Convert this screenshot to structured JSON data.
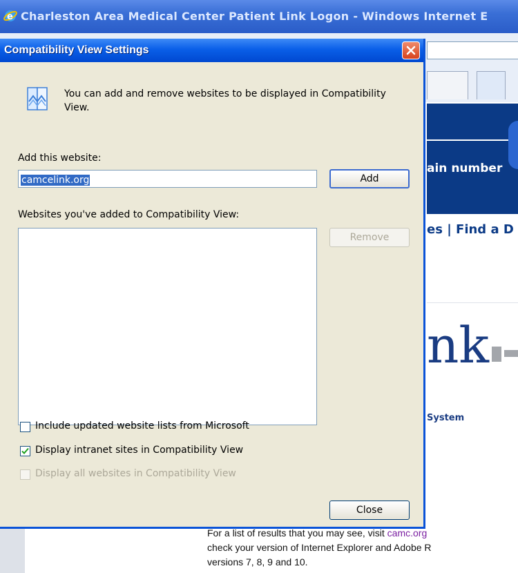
{
  "browser": {
    "window_title": "Charleston Area Medical Center Patient Link Logon - Windows Internet E",
    "site_text_main_number": "ain number",
    "site_nav_text": "es | Find a D",
    "site_logo_text": "nk",
    "site_system_text": "System",
    "page_lines": [
      "For a list of results that you may see, visit ",
      "check your version of Internet Explorer and Adobe R",
      "versions 7, 8, 9 and 10."
    ],
    "page_link": "camc.org"
  },
  "dialog": {
    "title": "Compatibility View Settings",
    "info_text": "You can add and remove websites to be displayed in Compatibility View.",
    "add_label": "Add this website:",
    "add_input_value": "camcelink.org",
    "add_button": "Add",
    "list_label": "Websites you've added to Compatibility View:",
    "list_items": [],
    "remove_button": "Remove",
    "checkboxes": [
      {
        "label": "Include updated website lists from Microsoft",
        "checked": false,
        "enabled": true
      },
      {
        "label": "Display intranet sites in Compatibility View",
        "checked": true,
        "enabled": true
      },
      {
        "label": "Display all websites in Compatibility View",
        "checked": false,
        "enabled": false
      }
    ],
    "close_button": "Close"
  }
}
